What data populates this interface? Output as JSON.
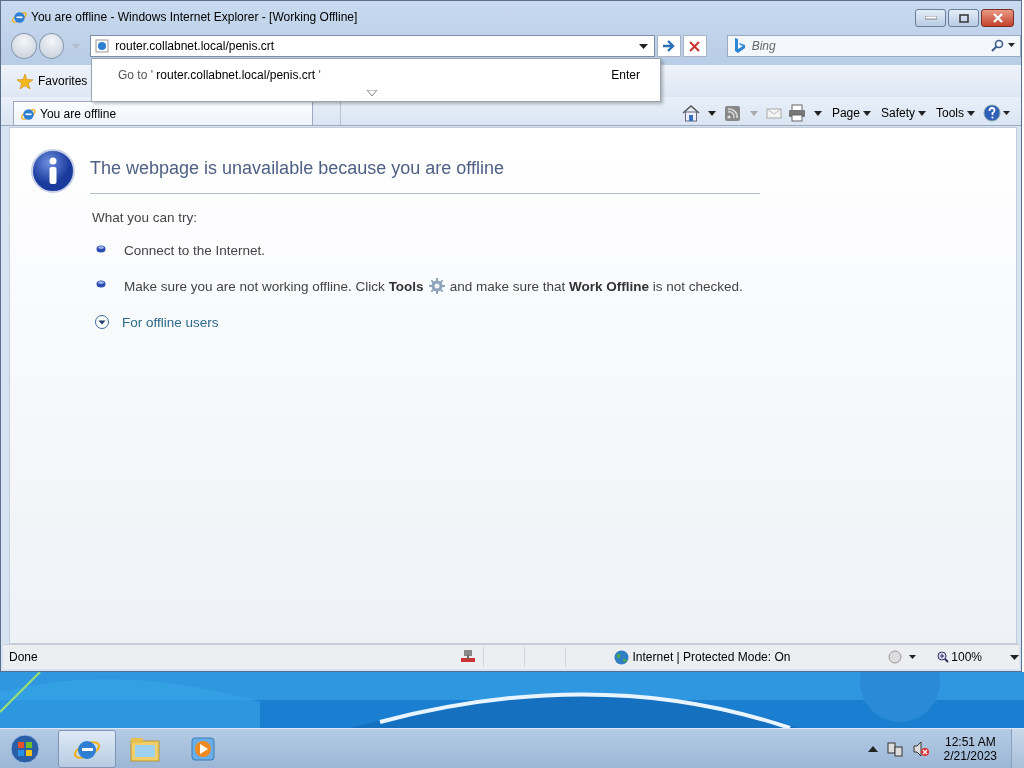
{
  "window": {
    "title": "You are offline - Windows Internet Explorer - [Working Offline]"
  },
  "address_bar": {
    "value": "router.collabnet.local/penis.crt"
  },
  "autocomplete": {
    "prefix": "Go to '",
    "url": "router.collabnet.local/penis.crt",
    "suffix": "'",
    "hint": "Enter"
  },
  "search": {
    "placeholder": "Bing"
  },
  "favorites": {
    "label": "Favorites"
  },
  "tabs": [
    {
      "label": "You are offline",
      "selected": true
    }
  ],
  "command_menus": [
    "Page",
    "Safety",
    "Tools"
  ],
  "page": {
    "heading": "The webpage is unavailable because you are offline",
    "intro": "What you can try:",
    "suggestions": [
      {
        "text": "Connect to the Internet."
      },
      {
        "text": "Make sure you are not working offline. Click **Tools**",
        "text_after": "and make sure that **Work Offline** is not checked."
      }
    ],
    "expander": {
      "label": "For offline users",
      "expanded": false
    }
  },
  "status_bar": {
    "text": "Done",
    "zone": "Internet | Protected Mode: On",
    "zoom": "100%"
  },
  "taskbar": {
    "time": "12:51 AM",
    "date": "2/21/2023"
  }
}
